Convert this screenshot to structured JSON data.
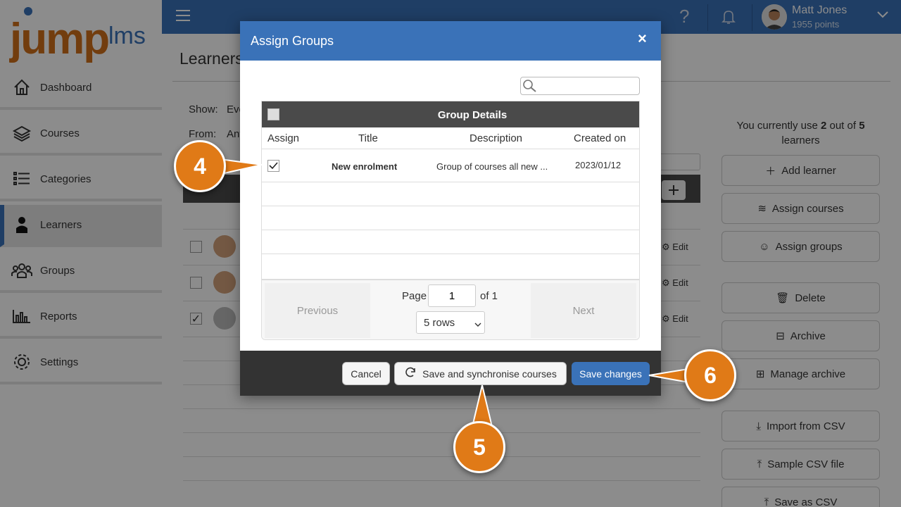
{
  "app": {
    "logo_main": "jump",
    "logo_sub": "lms"
  },
  "sidebar": {
    "items": [
      {
        "label": "Dashboard",
        "icon": "home-icon"
      },
      {
        "label": "Courses",
        "icon": "book-stack-icon"
      },
      {
        "label": "Categories",
        "icon": "list-icon"
      },
      {
        "label": "Learners",
        "icon": "person-icon"
      },
      {
        "label": "Groups",
        "icon": "people-icon"
      },
      {
        "label": "Reports",
        "icon": "bar-chart-icon"
      },
      {
        "label": "Settings",
        "icon": "gear-icon"
      }
    ],
    "active": "Learners"
  },
  "topbar": {
    "user_name": "Matt Jones",
    "user_points": "1955 points"
  },
  "main": {
    "page_title": "Learners",
    "show_label": "Show:",
    "show_value": "Eve",
    "from_label": "From:",
    "from_value": "Any",
    "row_edit_label": "Edit"
  },
  "right_panel": {
    "usage_prefix": "You currently use ",
    "usage_used": "2",
    "usage_mid": " out of ",
    "usage_total": "5",
    "usage_suffix": " learners",
    "buttons": [
      "Add learner",
      "Assign courses",
      "Assign groups",
      "Delete",
      "Archive",
      "Manage archive",
      "Import from CSV",
      "Sample CSV file",
      "Save as CSV"
    ]
  },
  "modal": {
    "title": "Assign Groups",
    "close": "×",
    "search_placeholder": "",
    "table_title": "Group Details",
    "columns": [
      "Assign",
      "Title",
      "Description",
      "Created on"
    ],
    "rows": [
      {
        "assigned": true,
        "title": "New enrolment",
        "description": "Group of courses all new ...",
        "created": "2023/01/12"
      }
    ],
    "pager": {
      "previous": "Previous",
      "next": "Next",
      "page_label": "Page",
      "page_value": "1",
      "of_label": "of 1",
      "rows_option": "5 rows"
    },
    "footer": {
      "cancel": "Cancel",
      "save_sync": "Save and synchronise courses",
      "save": "Save changes"
    }
  },
  "callouts": [
    "4",
    "5",
    "6"
  ],
  "colors": {
    "brand_blue": "#3a72b8",
    "brand_orange": "#e07a17",
    "dark_header": "#4a4a4a"
  }
}
